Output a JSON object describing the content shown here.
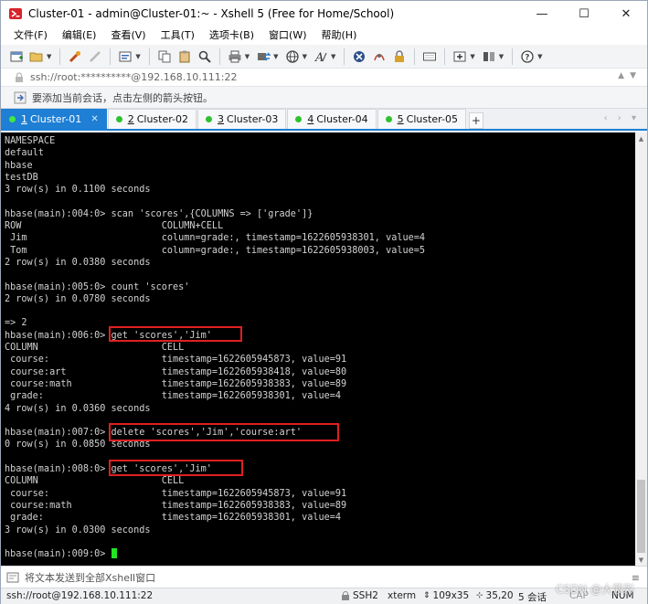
{
  "window": {
    "title": "Cluster-01 - admin@Cluster-01:~ - Xshell 5 (Free for Home/School)",
    "controls": {
      "minimize": "—",
      "maximize": "☐",
      "close": "✕"
    }
  },
  "menu": {
    "items": [
      "文件(F)",
      "编辑(E)",
      "查看(V)",
      "工具(T)",
      "选项卡(B)",
      "窗口(W)",
      "帮助(H)"
    ]
  },
  "address": {
    "value": "ssh://root:**********@192.168.10.111:22"
  },
  "hint": {
    "text": "要添加当前会话，点击左侧的箭头按钮。"
  },
  "tabs": [
    {
      "num": "1",
      "label": "Cluster-01"
    },
    {
      "num": "2",
      "label": "Cluster-02"
    },
    {
      "num": "3",
      "label": "Cluster-03"
    },
    {
      "num": "4",
      "label": "Cluster-04"
    },
    {
      "num": "5",
      "label": "Cluster-05"
    }
  ],
  "tab_add": "+",
  "terminal": {
    "lines": [
      "NAMESPACE",
      "default",
      "hbase",
      "testDB",
      "3 row(s) in 0.1100 seconds",
      "",
      "hbase(main):004:0> scan 'scores',{COLUMNS => ['grade']}",
      "ROW                         COLUMN+CELL",
      " Jim                        column=grade:, timestamp=1622605938301, value=4",
      " Tom                        column=grade:, timestamp=1622605938003, value=5",
      "2 row(s) in 0.0380 seconds",
      "",
      "hbase(main):005:0> count 'scores'",
      "2 row(s) in 0.0780 seconds",
      "",
      "=> 2",
      "hbase(main):006:0> get 'scores','Jim'",
      "COLUMN                      CELL",
      " course:                    timestamp=1622605945873, value=91",
      " course:art                 timestamp=1622605938418, value=80",
      " course:math                timestamp=1622605938383, value=89",
      " grade:                     timestamp=1622605938301, value=4",
      "4 row(s) in 0.0360 seconds",
      "",
      "hbase(main):007:0> delete 'scores','Jim','course:art'",
      "0 row(s) in 0.0850 seconds",
      "",
      "hbase(main):008:0> get 'scores','Jim'",
      "COLUMN                      CELL",
      " course:                    timestamp=1622605945873, value=91",
      " course:math                timestamp=1622605938383, value=89",
      " grade:                     timestamp=1622605938301, value=4",
      "3 row(s) in 0.0300 seconds",
      "",
      "hbase(main):009:0> "
    ]
  },
  "compose": {
    "text": "将文本发送到全部Xshell窗口"
  },
  "status": {
    "connection": "ssh://root@192.168.10.111:22",
    "protocol": "SSH2",
    "term": "xterm",
    "size": "109x35",
    "position": "35,20",
    "sessions": "5 会话",
    "caps": "CAP",
    "num": "NUM"
  },
  "watermark": "CSDN @大菠彩"
}
